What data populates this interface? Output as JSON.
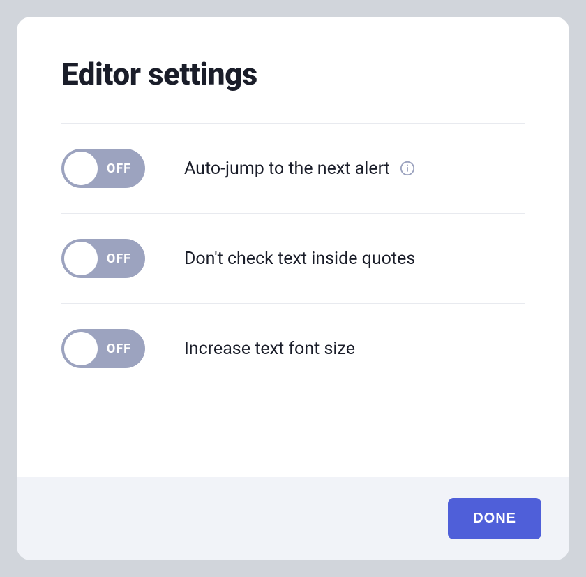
{
  "modal": {
    "title": "Editor settings",
    "settings": [
      {
        "toggle_state": "OFF",
        "label": "Auto-jump to the next alert",
        "has_info": true
      },
      {
        "toggle_state": "OFF",
        "label": "Don't check text inside quotes",
        "has_info": false
      },
      {
        "toggle_state": "OFF",
        "label": "Increase text font size",
        "has_info": false
      }
    ],
    "done_label": "DONE"
  }
}
